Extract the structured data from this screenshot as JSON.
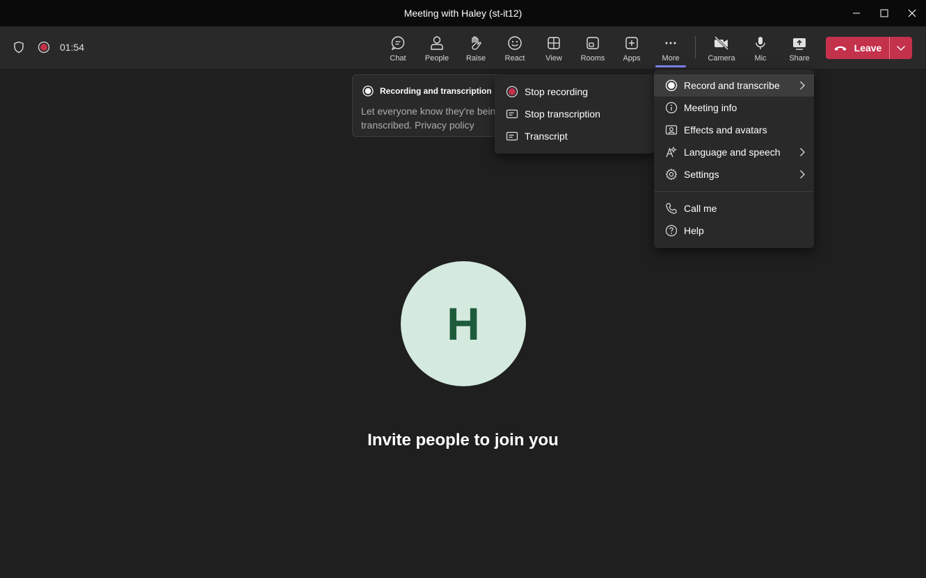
{
  "window": {
    "title": "Meeting with Haley (st-it12)"
  },
  "status": {
    "timer": "01:54"
  },
  "toolbar": {
    "buttons": [
      {
        "label": "Chat",
        "icon": "chat-icon"
      },
      {
        "label": "People",
        "icon": "people-icon"
      },
      {
        "label": "Raise",
        "icon": "raise-hand-icon"
      },
      {
        "label": "React",
        "icon": "smiley-icon"
      },
      {
        "label": "View",
        "icon": "grid-view-icon"
      },
      {
        "label": "Rooms",
        "icon": "rooms-icon"
      },
      {
        "label": "Apps",
        "icon": "add-app-icon"
      },
      {
        "label": "More",
        "icon": "more-icon"
      },
      {
        "label": "Camera",
        "icon": "camera-off-icon"
      },
      {
        "label": "Mic",
        "icon": "mic-icon"
      },
      {
        "label": "Share",
        "icon": "share-icon"
      }
    ],
    "leave_label": "Leave"
  },
  "notice": {
    "title": "Recording and transcription",
    "body": "Let everyone know they're being transcribed. Privacy policy"
  },
  "submenu": {
    "items": [
      {
        "label": "Stop recording",
        "icon": "record-icon"
      },
      {
        "label": "Stop transcription",
        "icon": "transcript-icon"
      },
      {
        "label": "Transcript",
        "icon": "transcript-icon"
      }
    ]
  },
  "more_menu": {
    "items": [
      {
        "label": "Record and transcribe",
        "icon": "record-icon",
        "submenu": true
      },
      {
        "label": "Meeting info",
        "icon": "info-icon",
        "submenu": false
      },
      {
        "label": "Effects and avatars",
        "icon": "effects-icon",
        "submenu": false
      },
      {
        "label": "Language and speech",
        "icon": "language-icon",
        "submenu": true
      },
      {
        "label": "Settings",
        "icon": "gear-icon",
        "submenu": true
      }
    ],
    "items2": [
      {
        "label": "Call me",
        "icon": "phone-icon"
      },
      {
        "label": "Help",
        "icon": "help-icon"
      }
    ]
  },
  "stage": {
    "avatar_initial": "H",
    "invite_text": "Invite people to join you"
  },
  "colors": {
    "leave": "#c4314b",
    "record": "#c4314b",
    "accent": "#7f85f5",
    "avatar_bg": "#d5eadf",
    "avatar_fg": "#1d5c3a"
  }
}
